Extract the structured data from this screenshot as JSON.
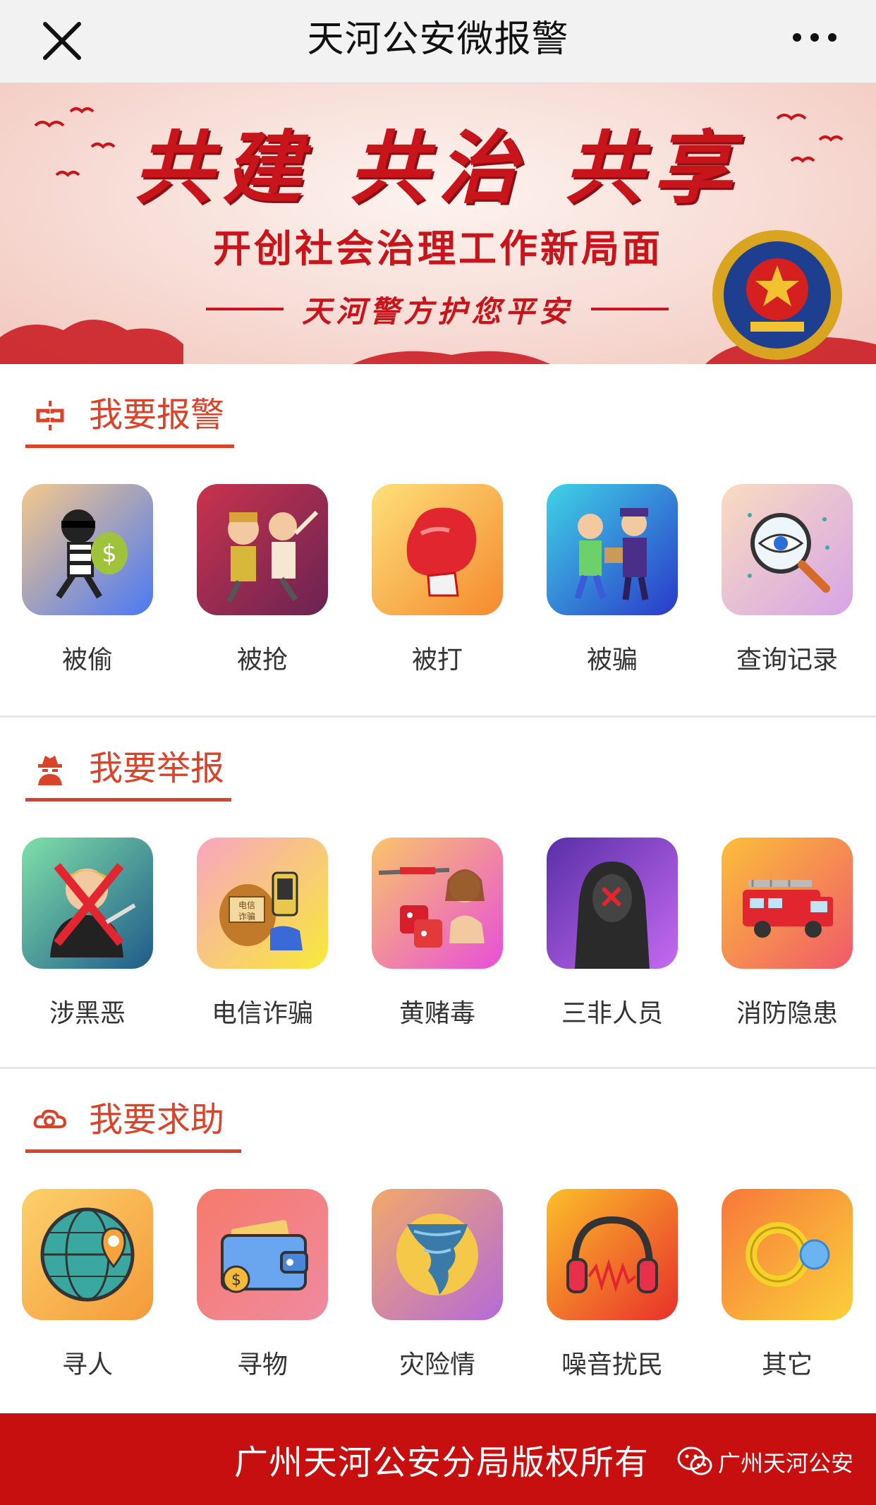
{
  "header": {
    "title": "天河公安微报警",
    "close_icon": "close-icon",
    "more_icon": "more-dots-icon"
  },
  "banner": {
    "headline": "共建 共治 共享",
    "subline": "开创社会治理工作新局面",
    "slogan": "天河警方护您平安"
  },
  "sections": [
    {
      "title": "我要报警",
      "icon": "alarm-link-icon",
      "items": [
        {
          "label": "被偷",
          "icon": "thief-icon"
        },
        {
          "label": "被抢",
          "icon": "robbery-icon"
        },
        {
          "label": "被打",
          "icon": "boxing-glove-icon"
        },
        {
          "label": "被骗",
          "icon": "fraud-exchange-icon"
        },
        {
          "label": "查询记录",
          "icon": "magnifier-eye-icon"
        }
      ]
    },
    {
      "title": "我要举报",
      "icon": "spy-icon",
      "items": [
        {
          "label": "涉黑恶",
          "icon": "gangster-crossed-icon"
        },
        {
          "label": "电信诈骗",
          "icon": "telecom-fraud-icon"
        },
        {
          "label": "黄赌毒",
          "icon": "drugs-gambling-icon"
        },
        {
          "label": "三非人员",
          "icon": "hooded-person-icon"
        },
        {
          "label": "消防隐患",
          "icon": "fire-truck-icon"
        }
      ]
    },
    {
      "title": "我要求助",
      "icon": "help-cloud-icon",
      "items": [
        {
          "label": "寻人",
          "icon": "globe-person-icon"
        },
        {
          "label": "寻物",
          "icon": "wallet-icon"
        },
        {
          "label": "灾险情",
          "icon": "tornado-icon"
        },
        {
          "label": "噪音扰民",
          "icon": "headphones-icon"
        },
        {
          "label": "其它",
          "icon": "rings-icon"
        }
      ]
    }
  ],
  "footer": {
    "copyright": "广州天河公安分局版权所有",
    "account": "广州天河公安"
  },
  "colors": {
    "accent": "#d8432a",
    "footer_bg": "#c70f0f",
    "banner_red": "#c8141b"
  }
}
